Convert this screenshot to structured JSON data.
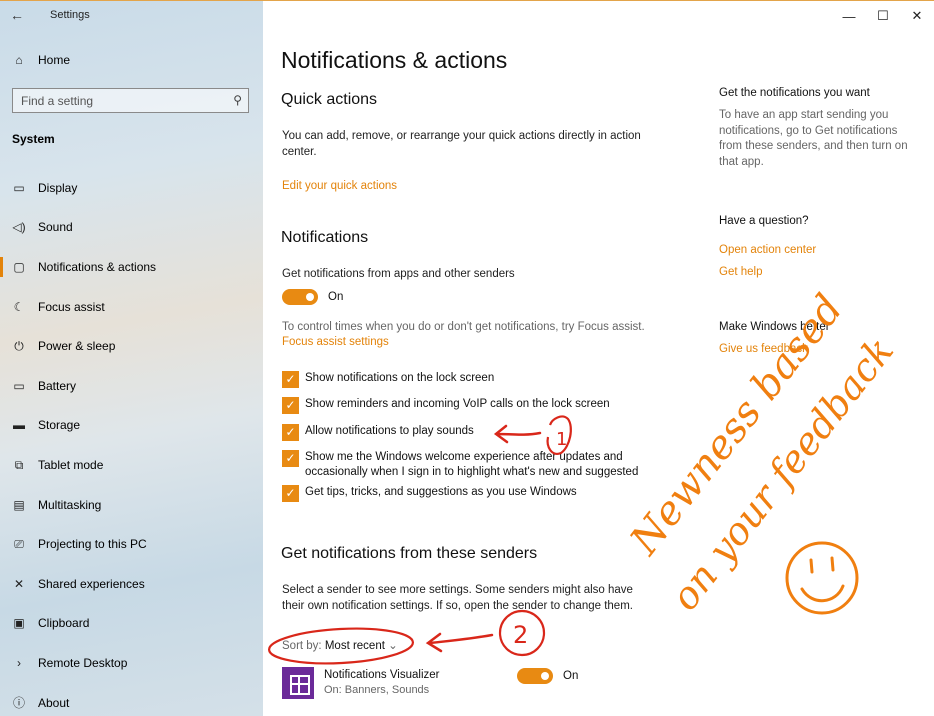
{
  "titlebar": {
    "app_title": "Settings",
    "back_icon": "back-arrow-icon",
    "minimize": "—",
    "maximize": "☐",
    "close": "✕"
  },
  "sidebar": {
    "home_label": "Home",
    "search_placeholder": "Find a setting",
    "section": "System",
    "items": [
      {
        "label": "Display",
        "icon": "▭"
      },
      {
        "label": "Sound",
        "icon": "◁)"
      },
      {
        "label": "Notifications & actions",
        "icon": "▢"
      },
      {
        "label": "Focus assist",
        "icon": "☾"
      },
      {
        "label": "Power & sleep",
        "icon": "⏻"
      },
      {
        "label": "Battery",
        "icon": "▭"
      },
      {
        "label": "Storage",
        "icon": "▬"
      },
      {
        "label": "Tablet mode",
        "icon": "⧉"
      },
      {
        "label": "Multitasking",
        "icon": "▤"
      },
      {
        "label": "Projecting to this PC",
        "icon": "⎚"
      },
      {
        "label": "Shared experiences",
        "icon": "✕"
      },
      {
        "label": "Clipboard",
        "icon": "▣"
      },
      {
        "label": "Remote Desktop",
        "icon": "›"
      },
      {
        "label": "About",
        "icon": "ⓘ"
      }
    ]
  },
  "main": {
    "title": "Notifications & actions",
    "quick_actions": {
      "heading": "Quick actions",
      "desc": "You can add, remove, or rearrange your quick actions directly in action center.",
      "link": "Edit your quick actions"
    },
    "notifications": {
      "heading": "Notifications",
      "get_label": "Get notifications from apps and other senders",
      "toggle_state": "On",
      "focus_text": "To control times when you do or don't get notifications, try Focus assist.",
      "focus_link": "Focus assist settings",
      "checkboxes": [
        "Show notifications on the lock screen",
        "Show reminders and incoming VoIP calls on the lock screen",
        "Allow notifications to play sounds",
        "Show me the Windows welcome experience after updates and occasionally when I sign in to highlight what's new and suggested",
        "Get tips, tricks, and suggestions as you use Windows"
      ]
    },
    "senders": {
      "heading": "Get notifications from these senders",
      "desc": "Select a sender to see more settings. Some senders might also have their own notification settings. If so, open the sender to change them.",
      "sort_label": "Sort by:",
      "sort_value": "Most recent",
      "items": [
        {
          "name": "Notifications Visualizer",
          "sub": "On: Banners, Sounds",
          "state": "On"
        }
      ]
    }
  },
  "right": {
    "h1": "Get the notifications you want",
    "p1": "To have an app start sending you notifications, go to Get notifications from these senders, and then turn on that app.",
    "h2": "Have a question?",
    "links2": [
      "Open action center",
      "Get help"
    ],
    "h3": "Make Windows better",
    "link3": "Give us feedback"
  },
  "annotation": {
    "line1": "Newness based",
    "line2": "on your feedback",
    "mark1": "1",
    "mark2": "2",
    "color": "#d9271a",
    "hand_color": "#f07f10"
  }
}
